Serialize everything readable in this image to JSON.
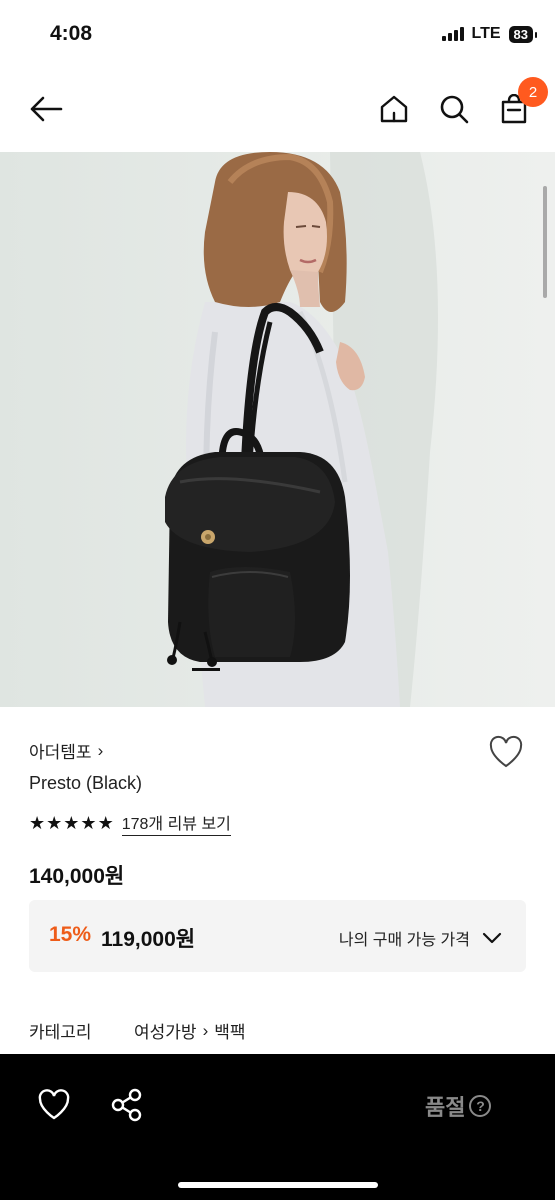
{
  "status_bar": {
    "time": "4:08",
    "network": "LTE",
    "battery": "83"
  },
  "nav": {
    "cart_count": "2",
    "icons": [
      "arrow-left-icon",
      "home-icon",
      "search-icon",
      "shopping-bag-icon"
    ]
  },
  "product": {
    "brand": "아더템포",
    "brand_chevron": "›",
    "name": "Presto (Black)",
    "rating_stars": 5,
    "review_link": "178개 리뷰 보기",
    "price": "140,000원",
    "discount": {
      "rate": "15%",
      "price": "119,000원",
      "buyable_label": "나의 구매 가능 가격"
    },
    "category": {
      "label": "카테고리",
      "path": [
        "여성가방",
        "백팩"
      ],
      "separator": "›"
    }
  },
  "bottom_bar": {
    "status_label": "품절",
    "help_glyph": "?"
  },
  "colors": {
    "accent": "#ff5a1f",
    "discount": "#ee5c19",
    "bottom_bar": "#000000",
    "disabled_text": "#8a8a8a"
  }
}
